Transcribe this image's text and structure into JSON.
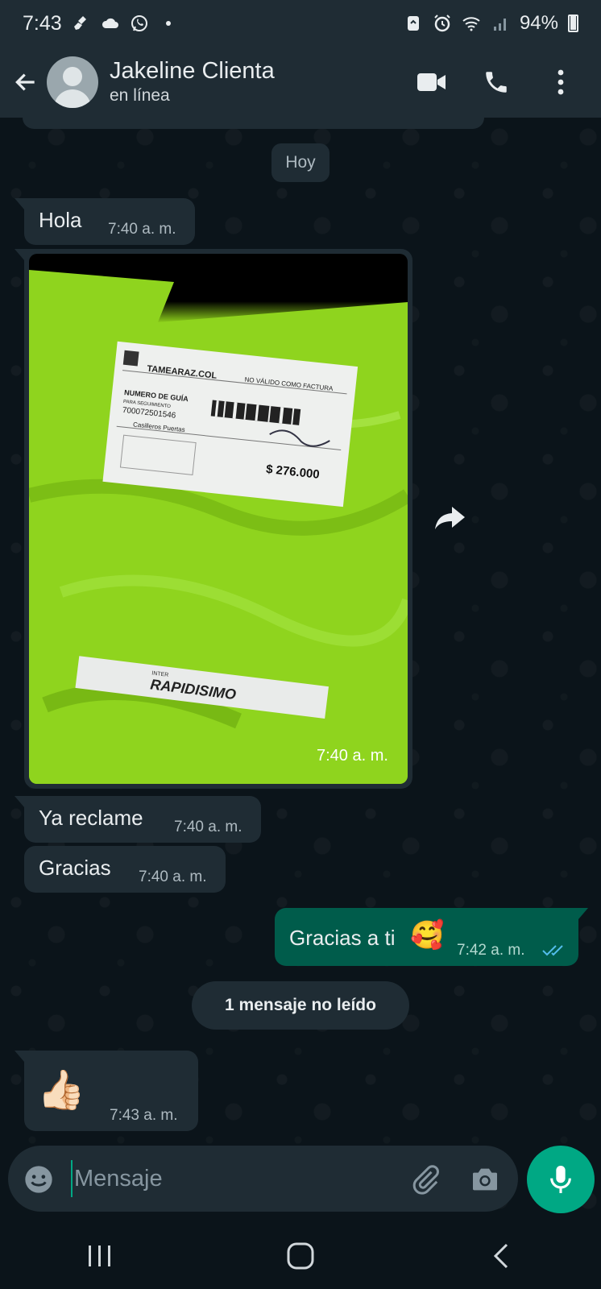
{
  "status_bar": {
    "time": "7:43",
    "battery": "94%",
    "left_icons": [
      "broom-icon",
      "cloud-icon",
      "whatsapp-icon",
      "dot-icon"
    ],
    "right_icons": [
      "recycle-icon",
      "alarm-icon",
      "wifi-icon",
      "signal-icon",
      "battery-icon"
    ]
  },
  "header": {
    "contact_name": "Jakeline Clienta",
    "contact_status": "en línea",
    "actions": [
      "video-call-icon",
      "phone-icon",
      "more-vert-icon"
    ]
  },
  "chat": {
    "date_label": "Hoy",
    "messages": [
      {
        "direction": "in",
        "text": "Hola",
        "time": "7:40 a. m."
      },
      {
        "direction": "in",
        "type": "image",
        "description": "photo-package",
        "time": "7:40 a. m."
      },
      {
        "direction": "in",
        "text": "Ya reclame",
        "time": "7:40 a. m."
      },
      {
        "direction": "in",
        "text": "Gracias",
        "time": "7:40 a. m."
      },
      {
        "direction": "out",
        "text": "Gracias a ti",
        "emoji": "🥰",
        "time": "7:42 a. m.",
        "status": "read"
      },
      {
        "direction": "in",
        "text": "👍🏻",
        "time": "7:43 a. m."
      }
    ],
    "unread_label": "1 mensaje no leído"
  },
  "photo_label": {
    "company": "TAMEARAZ.COL",
    "not_valid": "NO VÁLIDO COMO FACTURA",
    "guide_title": "NUMERO DE GUÍA",
    "guide_sub": "PARA SEGUIMIENTO",
    "guide_number": "700072501546",
    "amount": "$ 276.000",
    "contents": "Casilleros Puertas",
    "tape_text": "RAPIDISIMO",
    "tape_small": "INTER"
  },
  "composer": {
    "placeholder": "Mensaje"
  },
  "colors": {
    "header_bg": "#1f2c34",
    "chat_bg": "#0b141a",
    "incoming_bubble": "#1f2c34",
    "outgoing_bubble": "#005c4b",
    "accent": "#00a884",
    "read_ticks": "#53bdeb"
  }
}
